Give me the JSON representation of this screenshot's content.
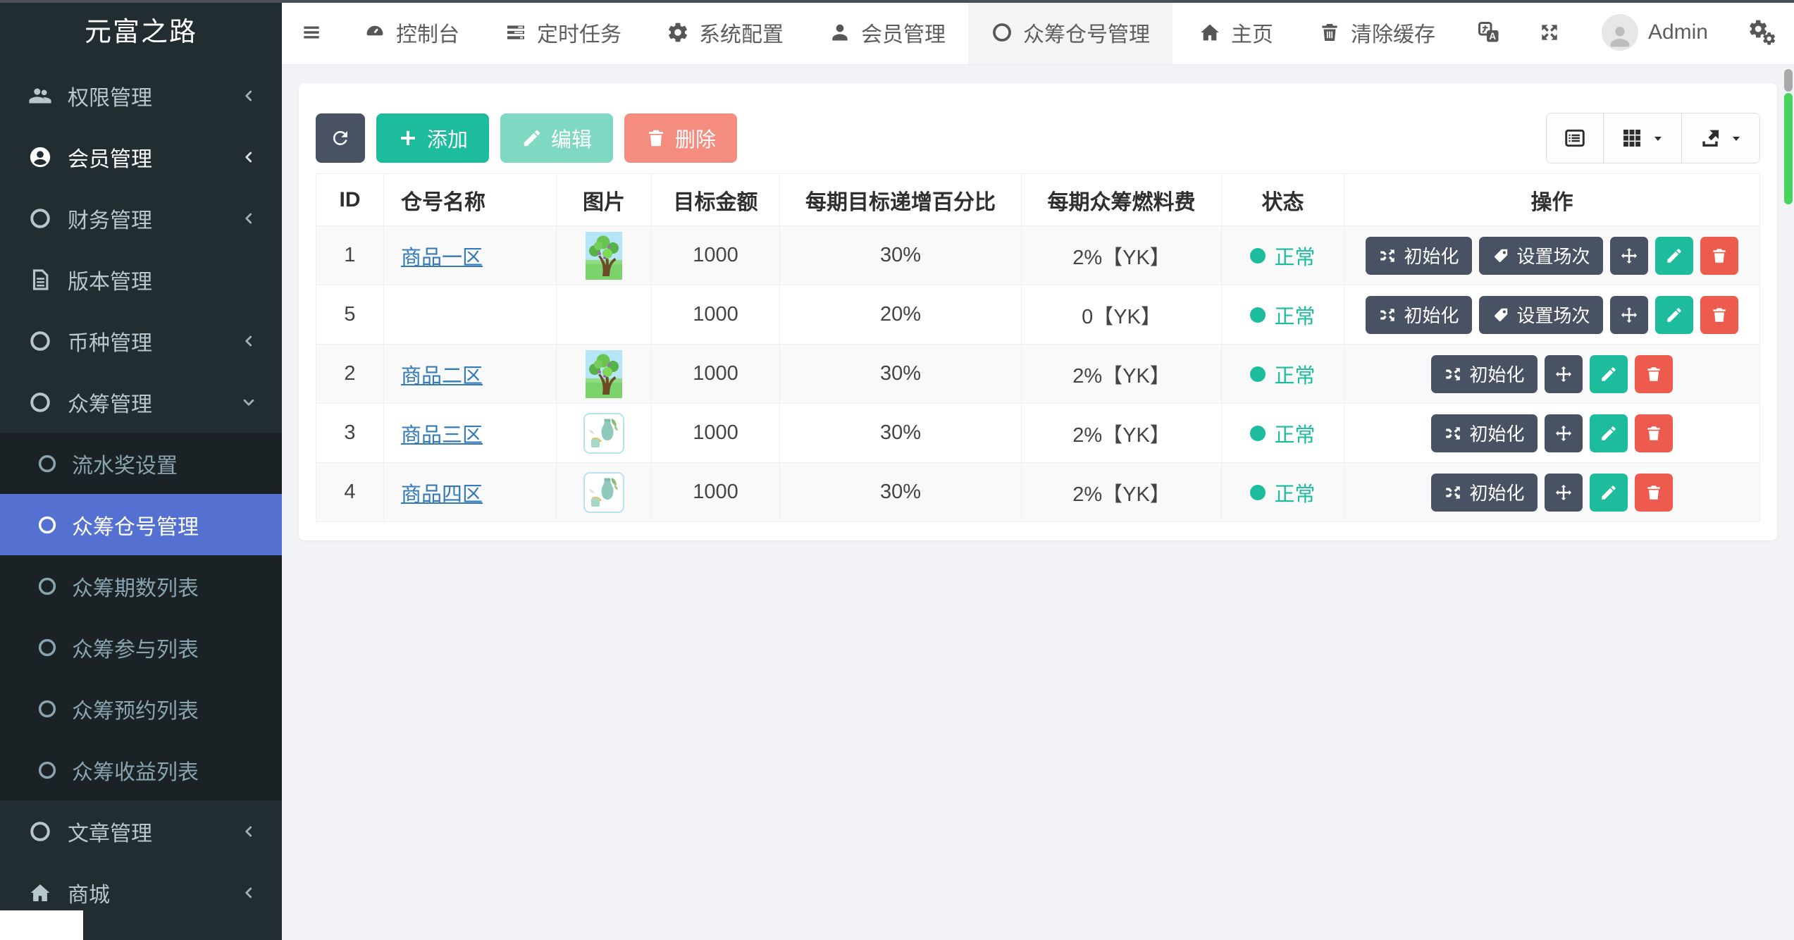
{
  "app": {
    "title": "元富之路"
  },
  "colors": {
    "sidebar_bg": "#222d32",
    "submenu_bg": "#1a2226",
    "active_blue": "#5471d2",
    "accent_green": "#1cbc9c",
    "danger_red": "#ed5a4e",
    "dark_button": "#485263",
    "link_blue": "#337ab7",
    "status_green": "#1cbc9c"
  },
  "sidebar": {
    "items": [
      {
        "label": "权限管理"
      },
      {
        "label": "会员管理"
      },
      {
        "label": "财务管理"
      },
      {
        "label": "版本管理"
      },
      {
        "label": "币种管理"
      },
      {
        "label": "众筹管理"
      }
    ],
    "submenu": [
      "流水奖设置",
      "众筹仓号管理",
      "众筹期数列表",
      "众筹参与列表",
      "众筹预约列表",
      "众筹收益列表"
    ],
    "active_submenu": "众筹仓号管理",
    "items_bottom": [
      {
        "label": "文章管理"
      },
      {
        "label": "商城"
      }
    ]
  },
  "topnav": {
    "items": [
      {
        "label": "控制台"
      },
      {
        "label": "定时任务"
      },
      {
        "label": "系统配置"
      },
      {
        "label": "会员管理"
      },
      {
        "label": "众筹仓号管理"
      }
    ],
    "active": "众筹仓号管理",
    "right": {
      "home": "主页",
      "clear_cache": "清除缓存",
      "username": "Admin"
    }
  },
  "toolbar": {
    "add_label": "添加",
    "edit_label": "编辑",
    "delete_label": "删除"
  },
  "actions": {
    "init_label": "初始化",
    "set_session_label": "设置场次"
  },
  "table": {
    "columns": [
      "ID",
      "仓号名称",
      "图片",
      "目标金额",
      "每期目标递增百分比",
      "每期众筹燃料费",
      "状态",
      "操作"
    ],
    "rows": [
      {
        "id": "1",
        "name": "商品一区",
        "money": "1000",
        "percent": "30%",
        "fuel": "2%【YK】",
        "status": "正常"
      },
      {
        "id": "5",
        "name": "",
        "money": "1000",
        "percent": "20%",
        "fuel": "0【YK】",
        "status": "正常"
      },
      {
        "id": "2",
        "name": "商品二区",
        "money": "1000",
        "percent": "30%",
        "fuel": "2%【YK】",
        "status": "正常"
      },
      {
        "id": "3",
        "name": "商品三区",
        "money": "1000",
        "percent": "30%",
        "fuel": "2%【YK】",
        "status": "正常"
      },
      {
        "id": "4",
        "name": "商品四区",
        "money": "1000",
        "percent": "30%",
        "fuel": "2%【YK】",
        "status": "正常"
      }
    ]
  }
}
